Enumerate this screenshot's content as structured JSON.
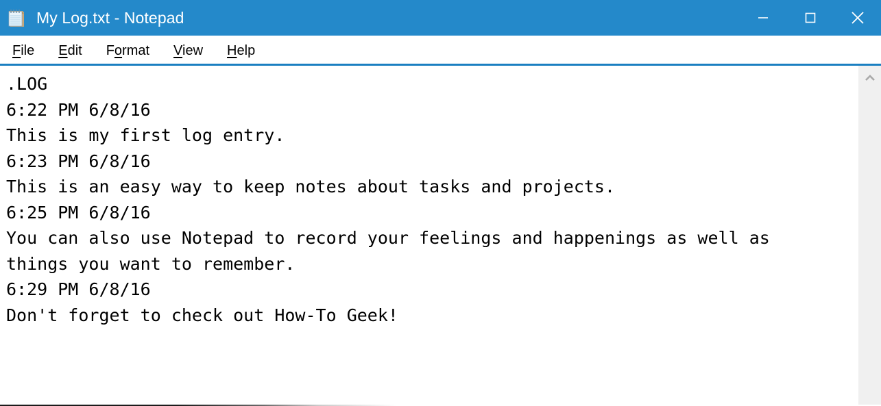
{
  "window": {
    "title": "My Log.txt - Notepad",
    "icon": "notepad-icon",
    "titlebar_color": "#2489ca",
    "title_color": "#ffffff",
    "accent_color": "#1a7fc1"
  },
  "caption_buttons": [
    {
      "name": "minimize",
      "label": "–",
      "icon": "minimize-icon"
    },
    {
      "name": "maximize",
      "label": "□",
      "icon": "maximize-icon"
    },
    {
      "name": "close",
      "label": "✕",
      "icon": "close-icon"
    }
  ],
  "menubar": {
    "items": [
      {
        "label": "File",
        "accesskey_index": 0
      },
      {
        "label": "Edit",
        "accesskey_index": 0
      },
      {
        "label": "Format",
        "accesskey_index": 1
      },
      {
        "label": "View",
        "accesskey_index": 0
      },
      {
        "label": "Help",
        "accesskey_index": 0
      }
    ]
  },
  "editor": {
    "filename": "My Log.txt",
    "lines": [
      ".LOG",
      "6:22 PM 6/8/16",
      "This is my first log entry.",
      "6:23 PM 6/8/16",
      "This is an easy way to keep notes about tasks and projects.",
      "6:25 PM 6/8/16",
      "You can also use Notepad to record your feelings and happenings as well as",
      "things you want to remember.",
      "6:29 PM 6/8/16",
      "Don't forget to check out How-To Geek!"
    ],
    "text_color": "#000000",
    "background_color": "#ffffff"
  },
  "scrollbar": {
    "orientation": "vertical",
    "up_arrow_icon": "chevron-up-icon",
    "track_color": "#f0f0f0"
  }
}
